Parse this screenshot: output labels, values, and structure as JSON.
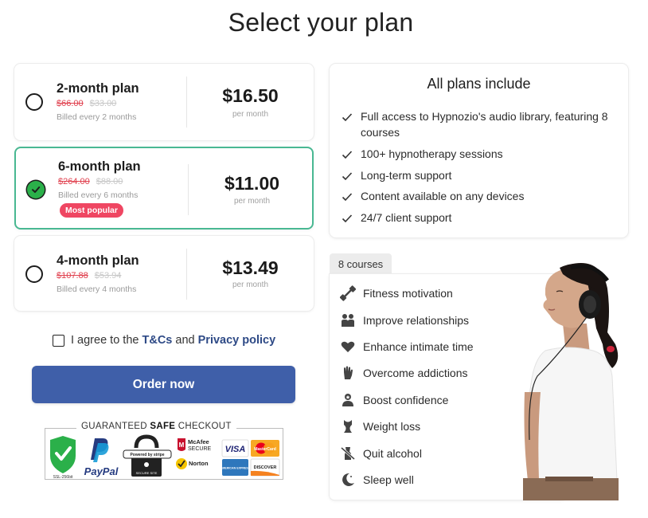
{
  "title": "Select your plan",
  "plans": [
    {
      "name": "2-month plan",
      "old_price": "$66.00",
      "mid_price": "$33.00",
      "billed": "Billed every 2 months",
      "price": "$16.50",
      "per": "per month",
      "selected": false
    },
    {
      "name": "6-month plan",
      "old_price": "$264.00",
      "mid_price": "$88.00",
      "billed": "Billed every 6 months",
      "price": "$11.00",
      "per": "per month",
      "selected": true,
      "badge": "Most popular"
    },
    {
      "name": "4-month plan",
      "old_price": "$107.88",
      "mid_price": "$53.94",
      "billed": "Billed every 4 months",
      "price": "$13.49",
      "per": "per month",
      "selected": false
    }
  ],
  "agree": {
    "prefix": "I agree to the",
    "tcs": "T&Cs",
    "and": "and",
    "privacy": "Privacy policy"
  },
  "order_button": "Order now",
  "secure_checkout": {
    "prefix": "GUARANTEED",
    "bold": "SAFE",
    "suffix": "CHECKOUT"
  },
  "badges": {
    "ssl": "SSL-256bit",
    "paypal": "PayPal",
    "stripe": "Powered by stripe",
    "secure_site": "SECURE SITE",
    "mcafee": "McAfee",
    "mcafee_sub": "SECURE",
    "norton": "Norton",
    "visa": "VISA",
    "mastercard": "MasterCard",
    "amex": "AMERICAN EXPRESS",
    "discover": "DISCOVER"
  },
  "includes": {
    "title": "All plans include",
    "items": [
      "Full access to Hypnozio's audio library, featuring 8 courses",
      "100+ hypnotherapy sessions",
      "Long-term support",
      "Content available on any devices",
      "24/7 client support"
    ]
  },
  "courses": {
    "tab": "8 courses",
    "items": [
      {
        "label": "Fitness motivation",
        "icon": "dumbbell-icon"
      },
      {
        "label": "Improve relationships",
        "icon": "people-icon"
      },
      {
        "label": "Enhance intimate time",
        "icon": "hearts-icon"
      },
      {
        "label": "Overcome addictions",
        "icon": "hand-stop-icon"
      },
      {
        "label": "Boost confidence",
        "icon": "person-star-icon"
      },
      {
        "label": "Weight loss",
        "icon": "scale-body-icon"
      },
      {
        "label": "Quit alcohol",
        "icon": "no-alcohol-icon"
      },
      {
        "label": "Sleep well",
        "icon": "moon-icon"
      }
    ]
  },
  "colors": {
    "accent": "#3f5fa9",
    "selected_border": "#49b892",
    "badge": "#ef4662",
    "check_green": "#2bb04a"
  }
}
